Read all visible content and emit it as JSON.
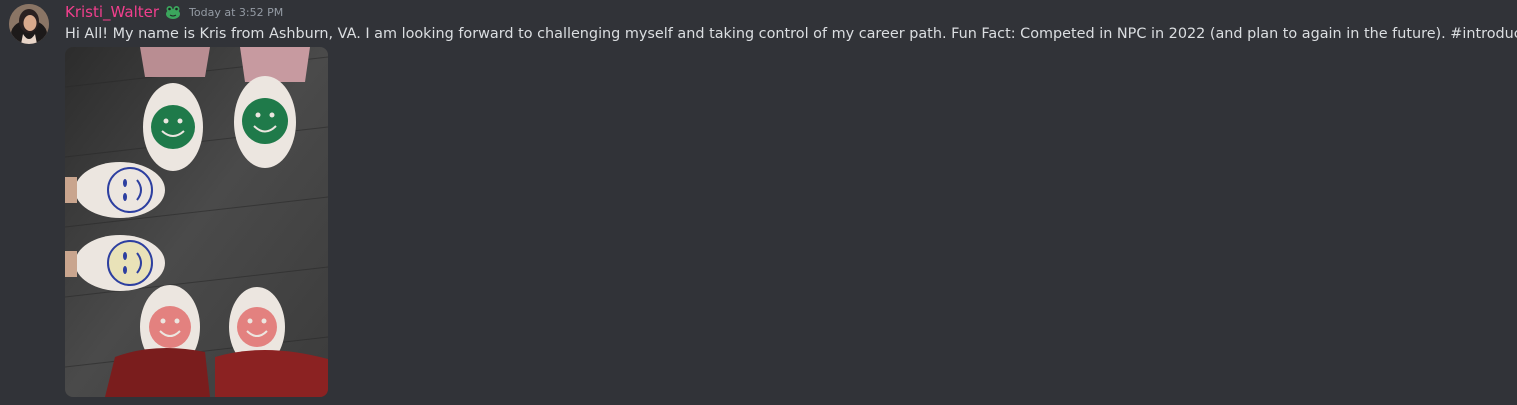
{
  "message": {
    "author": "Kristi_Walter",
    "author_color": "#f23f8d",
    "role_icon": "frog-icon",
    "timestamp": "Today at 3:52 PM",
    "text": "Hi All! My name is Kris from Ashburn, VA. I am looking forward to challenging myself and taking control of my career path. Fun Fact: Competed in NPC in 2022 (and plan to again in the future). #introductions",
    "attachment_icon": "photo-slippers"
  },
  "colors": {
    "background": "#313338",
    "text": "#dbdee1",
    "timestamp": "#949ba4"
  }
}
